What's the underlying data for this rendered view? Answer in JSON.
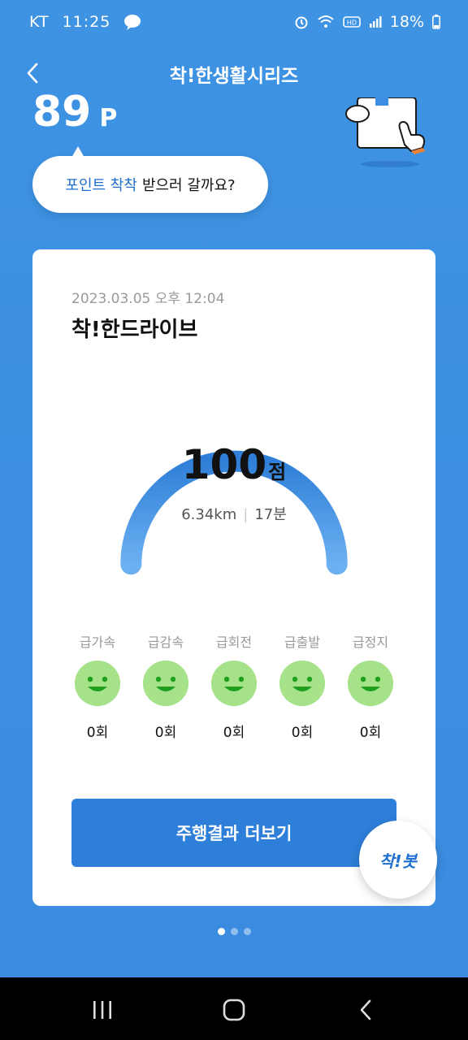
{
  "status_bar": {
    "carrier": "KT",
    "time": "11:25",
    "battery": "18%"
  },
  "header": {
    "title": "착!한생활시리즈"
  },
  "points": {
    "value": "89",
    "unit": "P"
  },
  "bubble": {
    "highlight": "포인트 착착",
    "text": "받으러 갈까요?"
  },
  "card": {
    "date": "2023.03.05 오후 12:04",
    "title": "착!한드라이브",
    "score": "100",
    "score_unit": "점",
    "distance": "6.34km",
    "duration": "17분",
    "events": [
      {
        "label": "급가속",
        "count": "0회"
      },
      {
        "label": "급감속",
        "count": "0회"
      },
      {
        "label": "급회전",
        "count": "0회"
      },
      {
        "label": "급출발",
        "count": "0회"
      },
      {
        "label": "급정지",
        "count": "0회"
      }
    ],
    "more_button": "주행결과 더보기"
  },
  "chatbot": {
    "label": "착!봇"
  },
  "pager": {
    "count": 3,
    "active": 1
  },
  "colors": {
    "primary": "#2e7fd9",
    "background": "#3b8ee2",
    "face": "#a5e28a"
  }
}
